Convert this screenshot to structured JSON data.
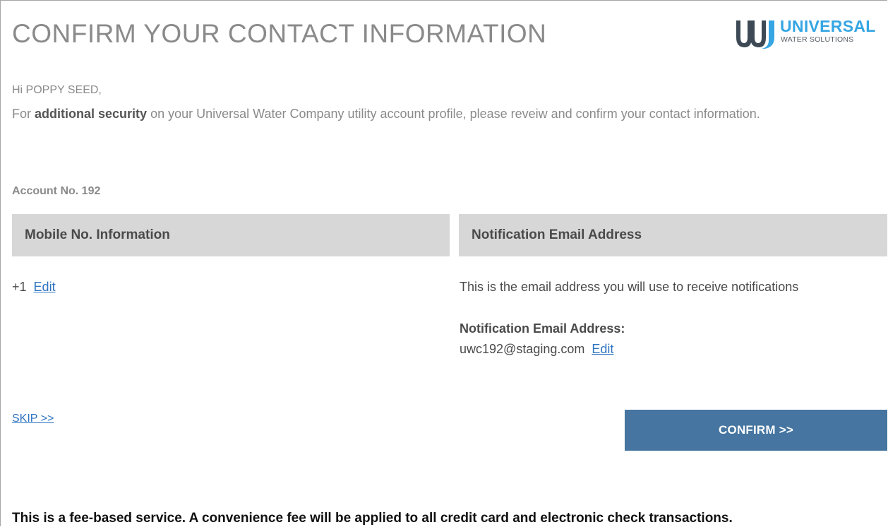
{
  "header": {
    "title": "CONFIRM YOUR CONTACT INFORMATION",
    "logo": {
      "icon": "uw-logo-icon",
      "wordmark": "UNIVERSAL",
      "subline": "WATER SOLUTIONS",
      "colors": {
        "dark": "#3d4a56",
        "blue": "#35a6e3"
      }
    }
  },
  "greeting": "Hi POPPY SEED,",
  "intro": {
    "before": "For ",
    "emphasis": "additional security",
    "after": " on your Universal Water Company utility account profile, please reveiw and confirm your contact information."
  },
  "account": {
    "label": "Account No. 192"
  },
  "mobile": {
    "heading": "Mobile No. Information",
    "value": "+1",
    "edit_label": "Edit"
  },
  "email": {
    "heading": "Notification Email Address",
    "description": "This is the email address you will use to receive notifications",
    "label": "Notification Email Address:",
    "value": "uwc192@staging.com",
    "edit_label": "Edit"
  },
  "actions": {
    "skip_label": "SKIP >>",
    "confirm_label": "CONFIRM >>"
  },
  "footer": {
    "fee_notice": "This is a fee-based service. A convenience fee will be applied to all credit card and electronic check transactions."
  },
  "colors": {
    "accent": "#4575a0",
    "link": "#2f74c0",
    "panel_header_bg": "#d7d7d7"
  }
}
